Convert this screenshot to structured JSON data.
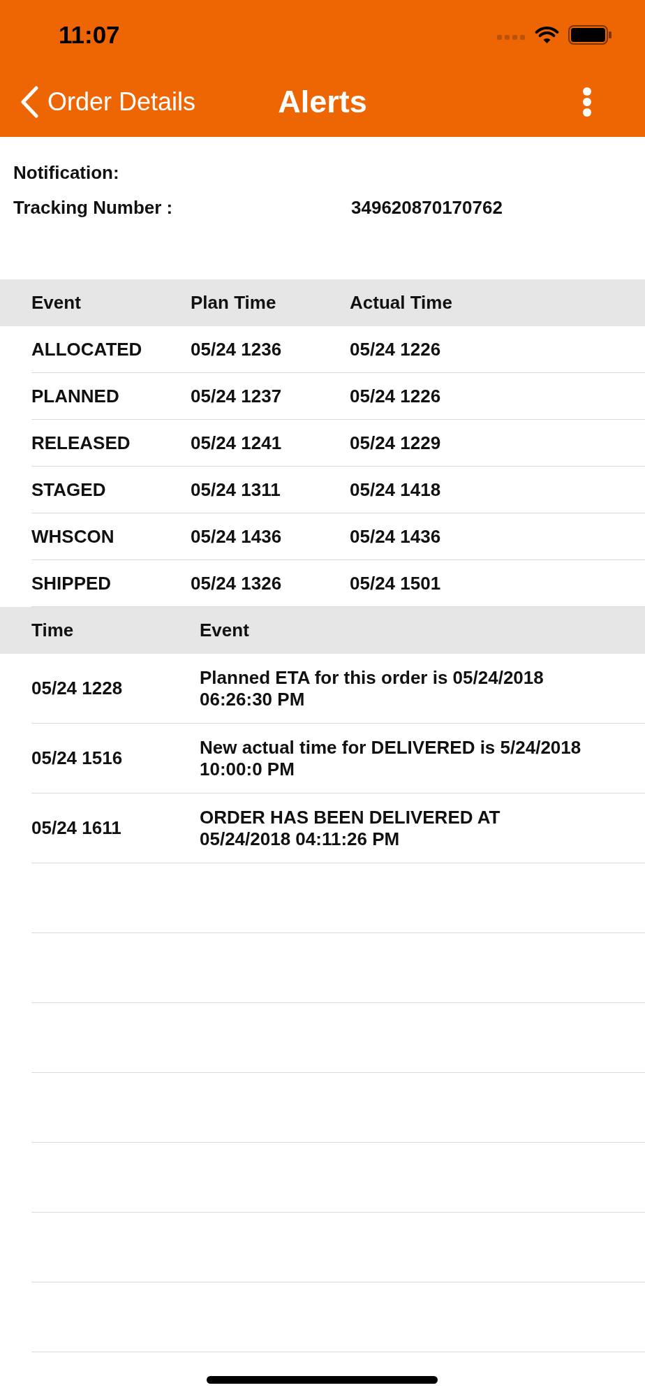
{
  "status_bar": {
    "time": "11:07"
  },
  "nav_bar": {
    "back_label": "Order Details",
    "title": "Alerts"
  },
  "details": [
    {
      "label": "Notification:"
    },
    {
      "label": "Tracking Number :",
      "value": "349620870170762"
    }
  ],
  "plan_table": {
    "columns": [
      "Event",
      "Plan Time",
      "Actual Time"
    ],
    "rows": [
      [
        "ALLOCATED",
        "05/24 1236",
        "05/24 1226"
      ],
      [
        "PLANNED",
        "05/24 1237",
        "05/24 1226"
      ],
      [
        "RELEASED",
        "05/24 1241",
        "05/24 1229"
      ],
      [
        "STAGED",
        "05/24 1311",
        "05/24 1418"
      ],
      [
        "WHSCON",
        "05/24 1436",
        "05/24 1436"
      ],
      [
        "SHIPPED",
        "05/24 1326",
        "05/24 1501"
      ]
    ]
  },
  "event_table": {
    "columns": [
      "Time",
      "Event"
    ],
    "rows": [
      [
        "05/24 1228",
        "Planned ETA for this order is 05/24/2018 06:26:30 PM"
      ],
      [
        "05/24 1516",
        "New actual time for DELIVERED is 5/24/2018 10:00:0 PM"
      ],
      [
        "05/24 1611",
        "ORDER HAS BEEN DELIVERED AT 05/24/2018 04:11:26 PM"
      ]
    ]
  }
}
